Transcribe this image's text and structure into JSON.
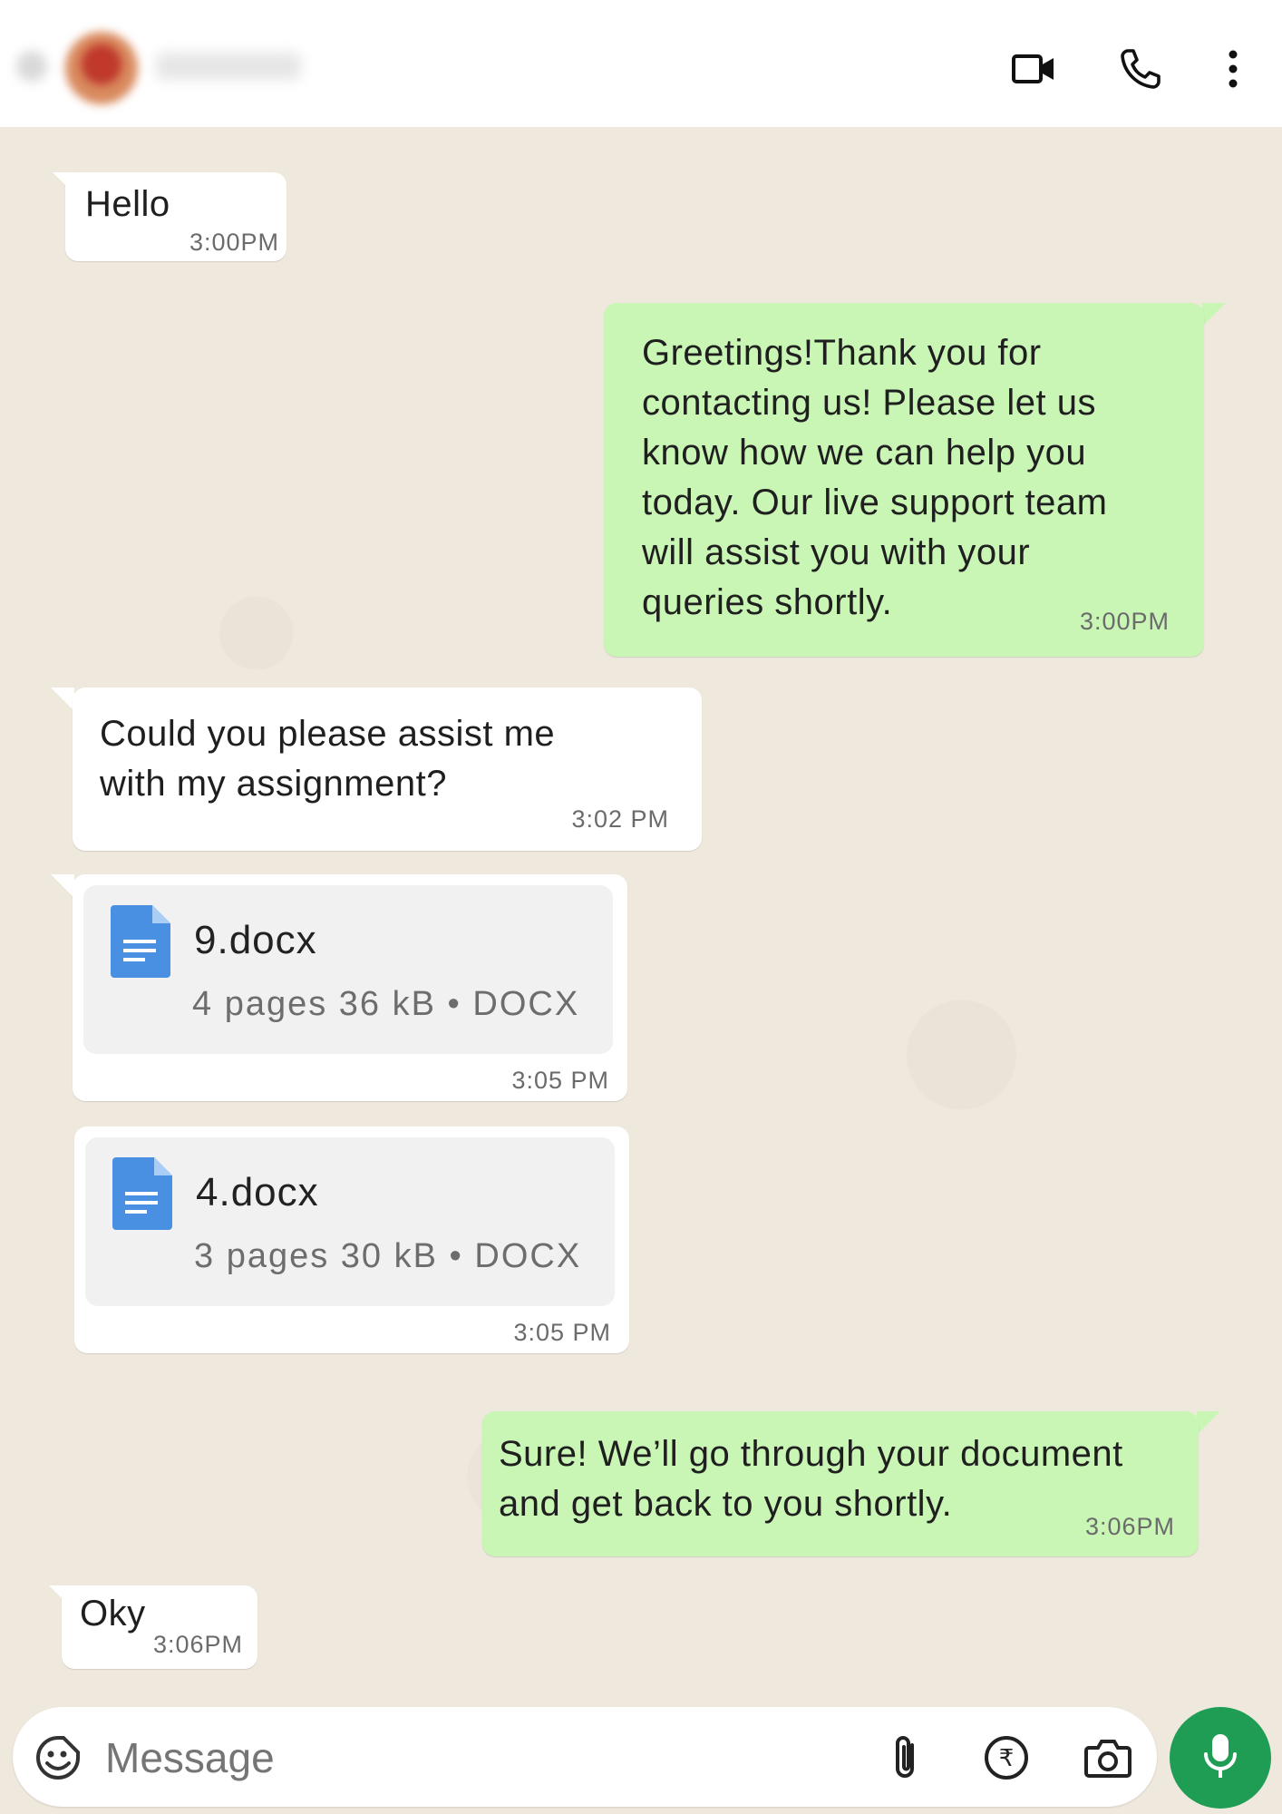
{
  "header": {
    "icons": [
      "video-call-icon",
      "voice-call-icon",
      "more-options-icon"
    ]
  },
  "messages": [
    {
      "dir": "in",
      "text": "Hello",
      "time": "3:00PM"
    },
    {
      "dir": "out",
      "lines": [
        "Greetings!Thank you for",
        "contacting us! Please let us",
        "know how we can help you",
        "today. Our live support team",
        "will assist you with your",
        "queries shortly."
      ],
      "time": "3:00PM"
    },
    {
      "dir": "in",
      "lines": [
        "Could you please assist me",
        "with my assignment?"
      ],
      "time": "3:02 PM"
    },
    {
      "dir": "in",
      "doc": {
        "name": "9.docx",
        "meta": "4 pages 36 kB • DOCX"
      },
      "time": "3:05 PM"
    },
    {
      "dir": "in",
      "doc": {
        "name": "4.docx",
        "meta": "3 pages 30 kB • DOCX"
      },
      "time": "3:05 PM"
    },
    {
      "dir": "out",
      "lines": [
        "Sure! We’ll go through your document",
        "and get back to you shortly."
      ],
      "time": "3:06PM"
    },
    {
      "dir": "in",
      "text": "Oky",
      "time": "3:06PM"
    }
  ],
  "composer": {
    "placeholder": "Message",
    "icons": [
      "emoji-icon",
      "attach-icon",
      "payment-icon",
      "camera-icon",
      "mic-icon"
    ]
  },
  "colors": {
    "incoming_bubble": "#ffffff",
    "outgoing_bubble": "#c9f5b5",
    "chat_background": "#efe8dd",
    "mic_button": "#1f9d55",
    "doc_icon": "#4a90e2"
  }
}
